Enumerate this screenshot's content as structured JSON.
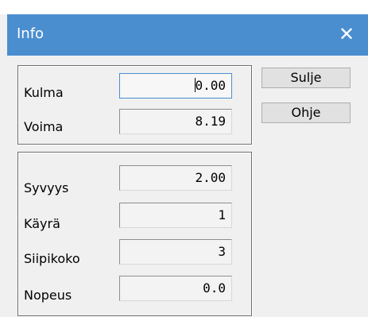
{
  "window": {
    "title": "Info",
    "close_glyph": "✕"
  },
  "colors": {
    "titlebar": "#4a8ed0",
    "background": "#f0f0f0",
    "button_face": "#e1e1e1"
  },
  "group1": {
    "rows": [
      {
        "label": "Kulma",
        "value": "0.00",
        "focused": true
      },
      {
        "label": "Voima",
        "value": "8.19",
        "focused": false
      }
    ]
  },
  "group2": {
    "rows": [
      {
        "label": "Syvyys",
        "value": "2.00"
      },
      {
        "label": "Käyrä",
        "value": "1"
      },
      {
        "label": "Siipikoko",
        "value": "3"
      },
      {
        "label": "Nopeus",
        "value": "0.0"
      }
    ]
  },
  "buttons": {
    "close_label": "Sulje",
    "help_label": "Ohje"
  }
}
